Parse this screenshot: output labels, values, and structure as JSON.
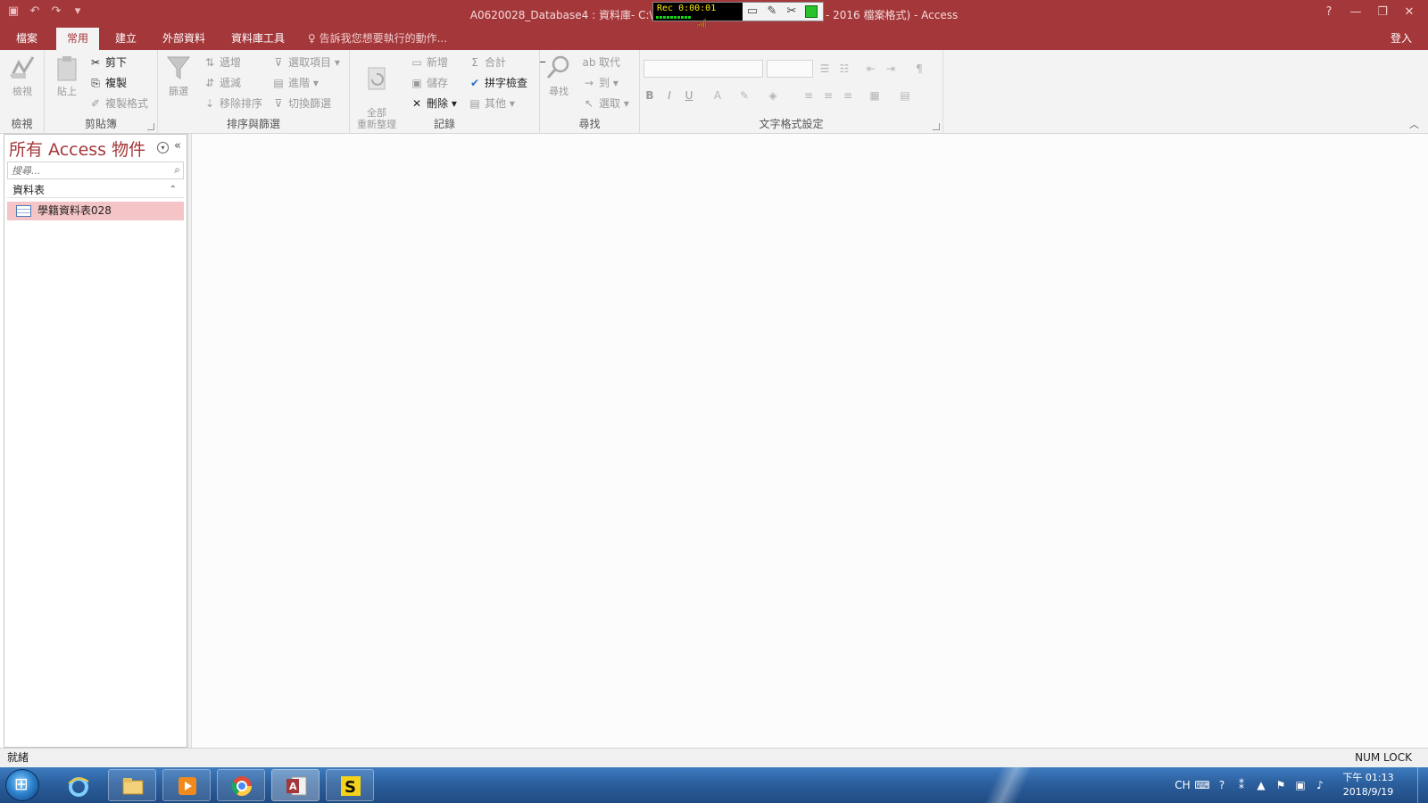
{
  "titlebar": {
    "title": "A0620028_Database4 : 資料庫- C:\\Users\\user\\Dow                    b (Access 2007 - 2016 檔案格式) - Access",
    "help": "?",
    "minimize": "—",
    "restore": "❐",
    "close": "✕",
    "qat_more": "▾"
  },
  "recorder": {
    "time": "Rec 0:00:01"
  },
  "tabs": [
    {
      "label": "檔案"
    },
    {
      "label": "常用"
    },
    {
      "label": "建立"
    },
    {
      "label": "外部資料"
    },
    {
      "label": "資料庫工具"
    }
  ],
  "tellme": "告訴我您想要執行的動作...",
  "signin": "登入",
  "ribbon": {
    "views": {
      "label": "檢視",
      "group": "檢視"
    },
    "clipboard": {
      "paste": "貼上",
      "cut": "剪下",
      "copy": "複製",
      "format_painter": "複製格式",
      "group": "剪貼簿"
    },
    "sort": {
      "filter": "篩選",
      "asc": "遞增",
      "desc": "遞減",
      "remove_sort": "移除排序",
      "selection": "選取項目",
      "advanced": "進階",
      "toggle": "切換篩選",
      "group": "排序與篩選"
    },
    "records": {
      "refresh": "全部\n重新整理",
      "new": "新增",
      "save": "儲存",
      "delete": "刪除",
      "totals": "合計",
      "spelling": "拼字檢查",
      "more": "其他",
      "group": "記錄"
    },
    "find": {
      "find": "尋找",
      "replace": "取代",
      "goto": "到",
      "select": "選取",
      "group": "尋找"
    },
    "text": {
      "bold": "B",
      "italic": "I",
      "underline": "U",
      "group": "文字格式設定"
    }
  },
  "nav": {
    "title": "所有 Access 物件",
    "search_placeholder": "搜尋...",
    "group": "資料表",
    "items": [
      {
        "label": "學籍資料表028"
      }
    ]
  },
  "status": {
    "left": "就緒",
    "right": "NUM LOCK"
  },
  "tray": {
    "lang": "CH",
    "time": "下午 01:13",
    "date": "2018/9/19"
  },
  "colors": {
    "accent": "#a4373a",
    "selected_item": "#f4c4c6"
  }
}
